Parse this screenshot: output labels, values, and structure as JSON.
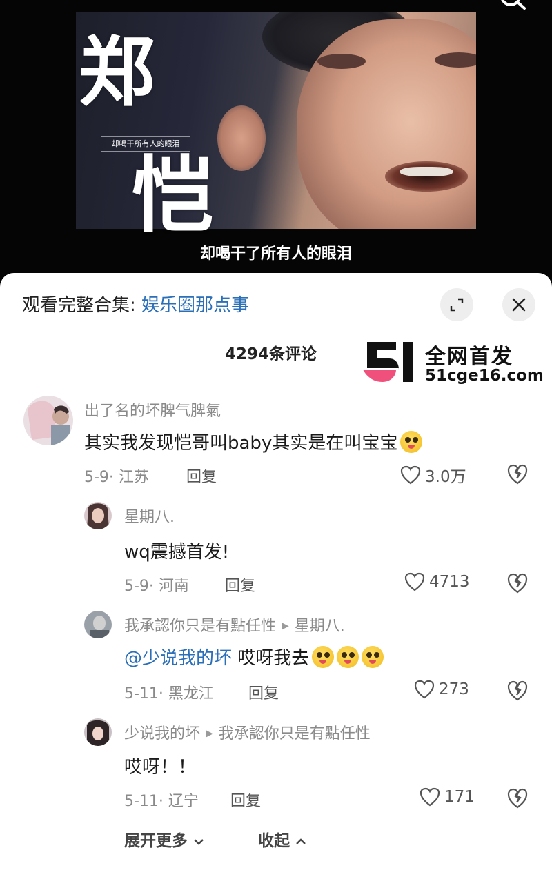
{
  "video": {
    "title_char_1": "郑",
    "title_char_2": "恺",
    "frame_subtitle": "却喝干所有人的眼泪",
    "caption": "却喝干了所有人的眼泪"
  },
  "sheet": {
    "collection_label": "观看完整合集: ",
    "collection_link": "娱乐圈那点事",
    "comment_count": "4294条评论"
  },
  "watermark": {
    "title": "全网首发",
    "url": "51cge16.com",
    "colors": {
      "pink": "#f0507c",
      "black": "#111111"
    }
  },
  "comments": [
    {
      "user": "出了名的坏脾气脾氣",
      "text": "其实我发现恺哥叫baby其实是在叫宝宝",
      "emoji": "dizzy-face-emoji",
      "meta": "5-9· 江苏",
      "reply": "回复",
      "likes": "3.0万"
    },
    {
      "user": "星期八.",
      "text": "wq震撼首发!",
      "meta": "5-9· 河南",
      "reply": "回复",
      "likes": "4713"
    },
    {
      "user": "我承認你只是有點任性",
      "reply_to": "星期八.",
      "mention": "@少说我的坏",
      "text": " 哎呀我去",
      "meta": "5-11· 黑龙江",
      "reply": "回复",
      "likes": "273"
    },
    {
      "user": "少说我的坏",
      "reply_to": "我承認你只是有點任性",
      "text": "哎呀！！",
      "meta": "5-11· 辽宁",
      "reply": "回复",
      "likes": "171"
    }
  ],
  "footer": {
    "expand_more": "展开更多",
    "collapse": "收起"
  }
}
